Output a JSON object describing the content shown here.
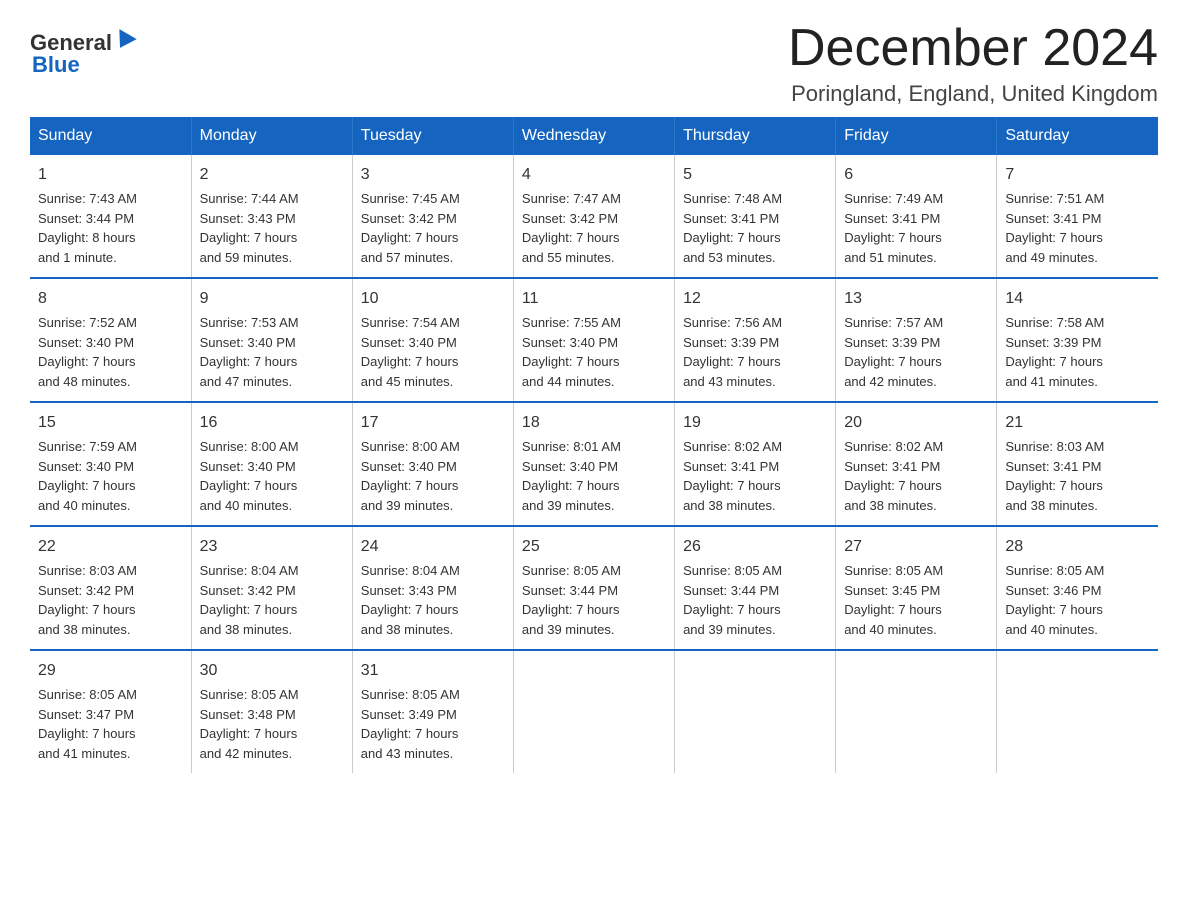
{
  "header": {
    "logo": {
      "general": "General",
      "blue": "Blue",
      "subtitle": "Blue"
    },
    "title": "December 2024",
    "location": "Poringland, England, United Kingdom"
  },
  "columns": [
    "Sunday",
    "Monday",
    "Tuesday",
    "Wednesday",
    "Thursday",
    "Friday",
    "Saturday"
  ],
  "weeks": [
    [
      {
        "day": "1",
        "info": "Sunrise: 7:43 AM\nSunset: 3:44 PM\nDaylight: 8 hours\nand 1 minute."
      },
      {
        "day": "2",
        "info": "Sunrise: 7:44 AM\nSunset: 3:43 PM\nDaylight: 7 hours\nand 59 minutes."
      },
      {
        "day": "3",
        "info": "Sunrise: 7:45 AM\nSunset: 3:42 PM\nDaylight: 7 hours\nand 57 minutes."
      },
      {
        "day": "4",
        "info": "Sunrise: 7:47 AM\nSunset: 3:42 PM\nDaylight: 7 hours\nand 55 minutes."
      },
      {
        "day": "5",
        "info": "Sunrise: 7:48 AM\nSunset: 3:41 PM\nDaylight: 7 hours\nand 53 minutes."
      },
      {
        "day": "6",
        "info": "Sunrise: 7:49 AM\nSunset: 3:41 PM\nDaylight: 7 hours\nand 51 minutes."
      },
      {
        "day": "7",
        "info": "Sunrise: 7:51 AM\nSunset: 3:41 PM\nDaylight: 7 hours\nand 49 minutes."
      }
    ],
    [
      {
        "day": "8",
        "info": "Sunrise: 7:52 AM\nSunset: 3:40 PM\nDaylight: 7 hours\nand 48 minutes."
      },
      {
        "day": "9",
        "info": "Sunrise: 7:53 AM\nSunset: 3:40 PM\nDaylight: 7 hours\nand 47 minutes."
      },
      {
        "day": "10",
        "info": "Sunrise: 7:54 AM\nSunset: 3:40 PM\nDaylight: 7 hours\nand 45 minutes."
      },
      {
        "day": "11",
        "info": "Sunrise: 7:55 AM\nSunset: 3:40 PM\nDaylight: 7 hours\nand 44 minutes."
      },
      {
        "day": "12",
        "info": "Sunrise: 7:56 AM\nSunset: 3:39 PM\nDaylight: 7 hours\nand 43 minutes."
      },
      {
        "day": "13",
        "info": "Sunrise: 7:57 AM\nSunset: 3:39 PM\nDaylight: 7 hours\nand 42 minutes."
      },
      {
        "day": "14",
        "info": "Sunrise: 7:58 AM\nSunset: 3:39 PM\nDaylight: 7 hours\nand 41 minutes."
      }
    ],
    [
      {
        "day": "15",
        "info": "Sunrise: 7:59 AM\nSunset: 3:40 PM\nDaylight: 7 hours\nand 40 minutes."
      },
      {
        "day": "16",
        "info": "Sunrise: 8:00 AM\nSunset: 3:40 PM\nDaylight: 7 hours\nand 40 minutes."
      },
      {
        "day": "17",
        "info": "Sunrise: 8:00 AM\nSunset: 3:40 PM\nDaylight: 7 hours\nand 39 minutes."
      },
      {
        "day": "18",
        "info": "Sunrise: 8:01 AM\nSunset: 3:40 PM\nDaylight: 7 hours\nand 39 minutes."
      },
      {
        "day": "19",
        "info": "Sunrise: 8:02 AM\nSunset: 3:41 PM\nDaylight: 7 hours\nand 38 minutes."
      },
      {
        "day": "20",
        "info": "Sunrise: 8:02 AM\nSunset: 3:41 PM\nDaylight: 7 hours\nand 38 minutes."
      },
      {
        "day": "21",
        "info": "Sunrise: 8:03 AM\nSunset: 3:41 PM\nDaylight: 7 hours\nand 38 minutes."
      }
    ],
    [
      {
        "day": "22",
        "info": "Sunrise: 8:03 AM\nSunset: 3:42 PM\nDaylight: 7 hours\nand 38 minutes."
      },
      {
        "day": "23",
        "info": "Sunrise: 8:04 AM\nSunset: 3:42 PM\nDaylight: 7 hours\nand 38 minutes."
      },
      {
        "day": "24",
        "info": "Sunrise: 8:04 AM\nSunset: 3:43 PM\nDaylight: 7 hours\nand 38 minutes."
      },
      {
        "day": "25",
        "info": "Sunrise: 8:05 AM\nSunset: 3:44 PM\nDaylight: 7 hours\nand 39 minutes."
      },
      {
        "day": "26",
        "info": "Sunrise: 8:05 AM\nSunset: 3:44 PM\nDaylight: 7 hours\nand 39 minutes."
      },
      {
        "day": "27",
        "info": "Sunrise: 8:05 AM\nSunset: 3:45 PM\nDaylight: 7 hours\nand 40 minutes."
      },
      {
        "day": "28",
        "info": "Sunrise: 8:05 AM\nSunset: 3:46 PM\nDaylight: 7 hours\nand 40 minutes."
      }
    ],
    [
      {
        "day": "29",
        "info": "Sunrise: 8:05 AM\nSunset: 3:47 PM\nDaylight: 7 hours\nand 41 minutes."
      },
      {
        "day": "30",
        "info": "Sunrise: 8:05 AM\nSunset: 3:48 PM\nDaylight: 7 hours\nand 42 minutes."
      },
      {
        "day": "31",
        "info": "Sunrise: 8:05 AM\nSunset: 3:49 PM\nDaylight: 7 hours\nand 43 minutes."
      },
      {
        "day": "",
        "info": ""
      },
      {
        "day": "",
        "info": ""
      },
      {
        "day": "",
        "info": ""
      },
      {
        "day": "",
        "info": ""
      }
    ]
  ]
}
